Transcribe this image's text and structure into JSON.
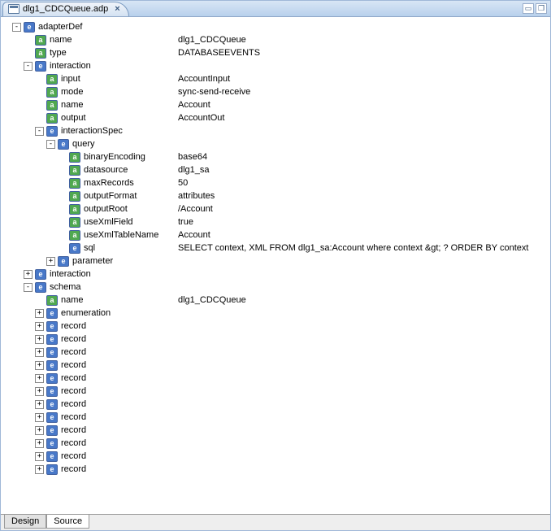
{
  "tab": {
    "title": "dlg1_CDCQueue.adp"
  },
  "footer": {
    "design": "Design",
    "source": "Source"
  },
  "rows": [
    {
      "indent": 14,
      "toggle": "-",
      "badge": "e",
      "label": "adapterDef",
      "value": ""
    },
    {
      "indent": 28,
      "toggle": "",
      "badge": "a",
      "label": "name",
      "value": "dlg1_CDCQueue"
    },
    {
      "indent": 28,
      "toggle": "",
      "badge": "a",
      "label": "type",
      "value": "DATABASEEVENTS"
    },
    {
      "indent": 28,
      "toggle": "-",
      "badge": "e",
      "label": "interaction",
      "value": ""
    },
    {
      "indent": 42,
      "toggle": "",
      "badge": "a",
      "label": "input",
      "value": "AccountInput"
    },
    {
      "indent": 42,
      "toggle": "",
      "badge": "a",
      "label": "mode",
      "value": "sync-send-receive"
    },
    {
      "indent": 42,
      "toggle": "",
      "badge": "a",
      "label": "name",
      "value": "Account"
    },
    {
      "indent": 42,
      "toggle": "",
      "badge": "a",
      "label": "output",
      "value": "AccountOut"
    },
    {
      "indent": 42,
      "toggle": "-",
      "badge": "e",
      "label": "interactionSpec",
      "value": ""
    },
    {
      "indent": 56,
      "toggle": "-",
      "badge": "e",
      "label": "query",
      "value": ""
    },
    {
      "indent": 70,
      "toggle": "",
      "badge": "a",
      "label": "binaryEncoding",
      "value": "base64"
    },
    {
      "indent": 70,
      "toggle": "",
      "badge": "a",
      "label": "datasource",
      "value": "dlg1_sa"
    },
    {
      "indent": 70,
      "toggle": "",
      "badge": "a",
      "label": "maxRecords",
      "value": "50"
    },
    {
      "indent": 70,
      "toggle": "",
      "badge": "a",
      "label": "outputFormat",
      "value": "attributes"
    },
    {
      "indent": 70,
      "toggle": "",
      "badge": "a",
      "label": "outputRoot",
      "value": "/Account"
    },
    {
      "indent": 70,
      "toggle": "",
      "badge": "a",
      "label": "useXmlField",
      "value": "true"
    },
    {
      "indent": 70,
      "toggle": "",
      "badge": "a",
      "label": "useXmlTableName",
      "value": "Account"
    },
    {
      "indent": 70,
      "toggle": "",
      "badge": "e",
      "label": "sql",
      "value": "SELECT context, XML FROM dlg1_sa:Account where context &gt; ? ORDER BY context"
    },
    {
      "indent": 56,
      "toggle": "+",
      "badge": "e",
      "label": "parameter",
      "value": ""
    },
    {
      "indent": 28,
      "toggle": "+",
      "badge": "e",
      "label": "interaction",
      "value": ""
    },
    {
      "indent": 28,
      "toggle": "-",
      "badge": "e",
      "label": "schema",
      "value": ""
    },
    {
      "indent": 42,
      "toggle": "",
      "badge": "a",
      "label": "name",
      "value": "dlg1_CDCQueue"
    },
    {
      "indent": 42,
      "toggle": "+",
      "badge": "e",
      "label": "enumeration",
      "value": ""
    },
    {
      "indent": 42,
      "toggle": "+",
      "badge": "e",
      "label": "record",
      "value": ""
    },
    {
      "indent": 42,
      "toggle": "+",
      "badge": "e",
      "label": "record",
      "value": ""
    },
    {
      "indent": 42,
      "toggle": "+",
      "badge": "e",
      "label": "record",
      "value": ""
    },
    {
      "indent": 42,
      "toggle": "+",
      "badge": "e",
      "label": "record",
      "value": ""
    },
    {
      "indent": 42,
      "toggle": "+",
      "badge": "e",
      "label": "record",
      "value": ""
    },
    {
      "indent": 42,
      "toggle": "+",
      "badge": "e",
      "label": "record",
      "value": ""
    },
    {
      "indent": 42,
      "toggle": "+",
      "badge": "e",
      "label": "record",
      "value": ""
    },
    {
      "indent": 42,
      "toggle": "+",
      "badge": "e",
      "label": "record",
      "value": ""
    },
    {
      "indent": 42,
      "toggle": "+",
      "badge": "e",
      "label": "record",
      "value": ""
    },
    {
      "indent": 42,
      "toggle": "+",
      "badge": "e",
      "label": "record",
      "value": ""
    },
    {
      "indent": 42,
      "toggle": "+",
      "badge": "e",
      "label": "record",
      "value": ""
    },
    {
      "indent": 42,
      "toggle": "+",
      "badge": "e",
      "label": "record",
      "value": ""
    }
  ]
}
